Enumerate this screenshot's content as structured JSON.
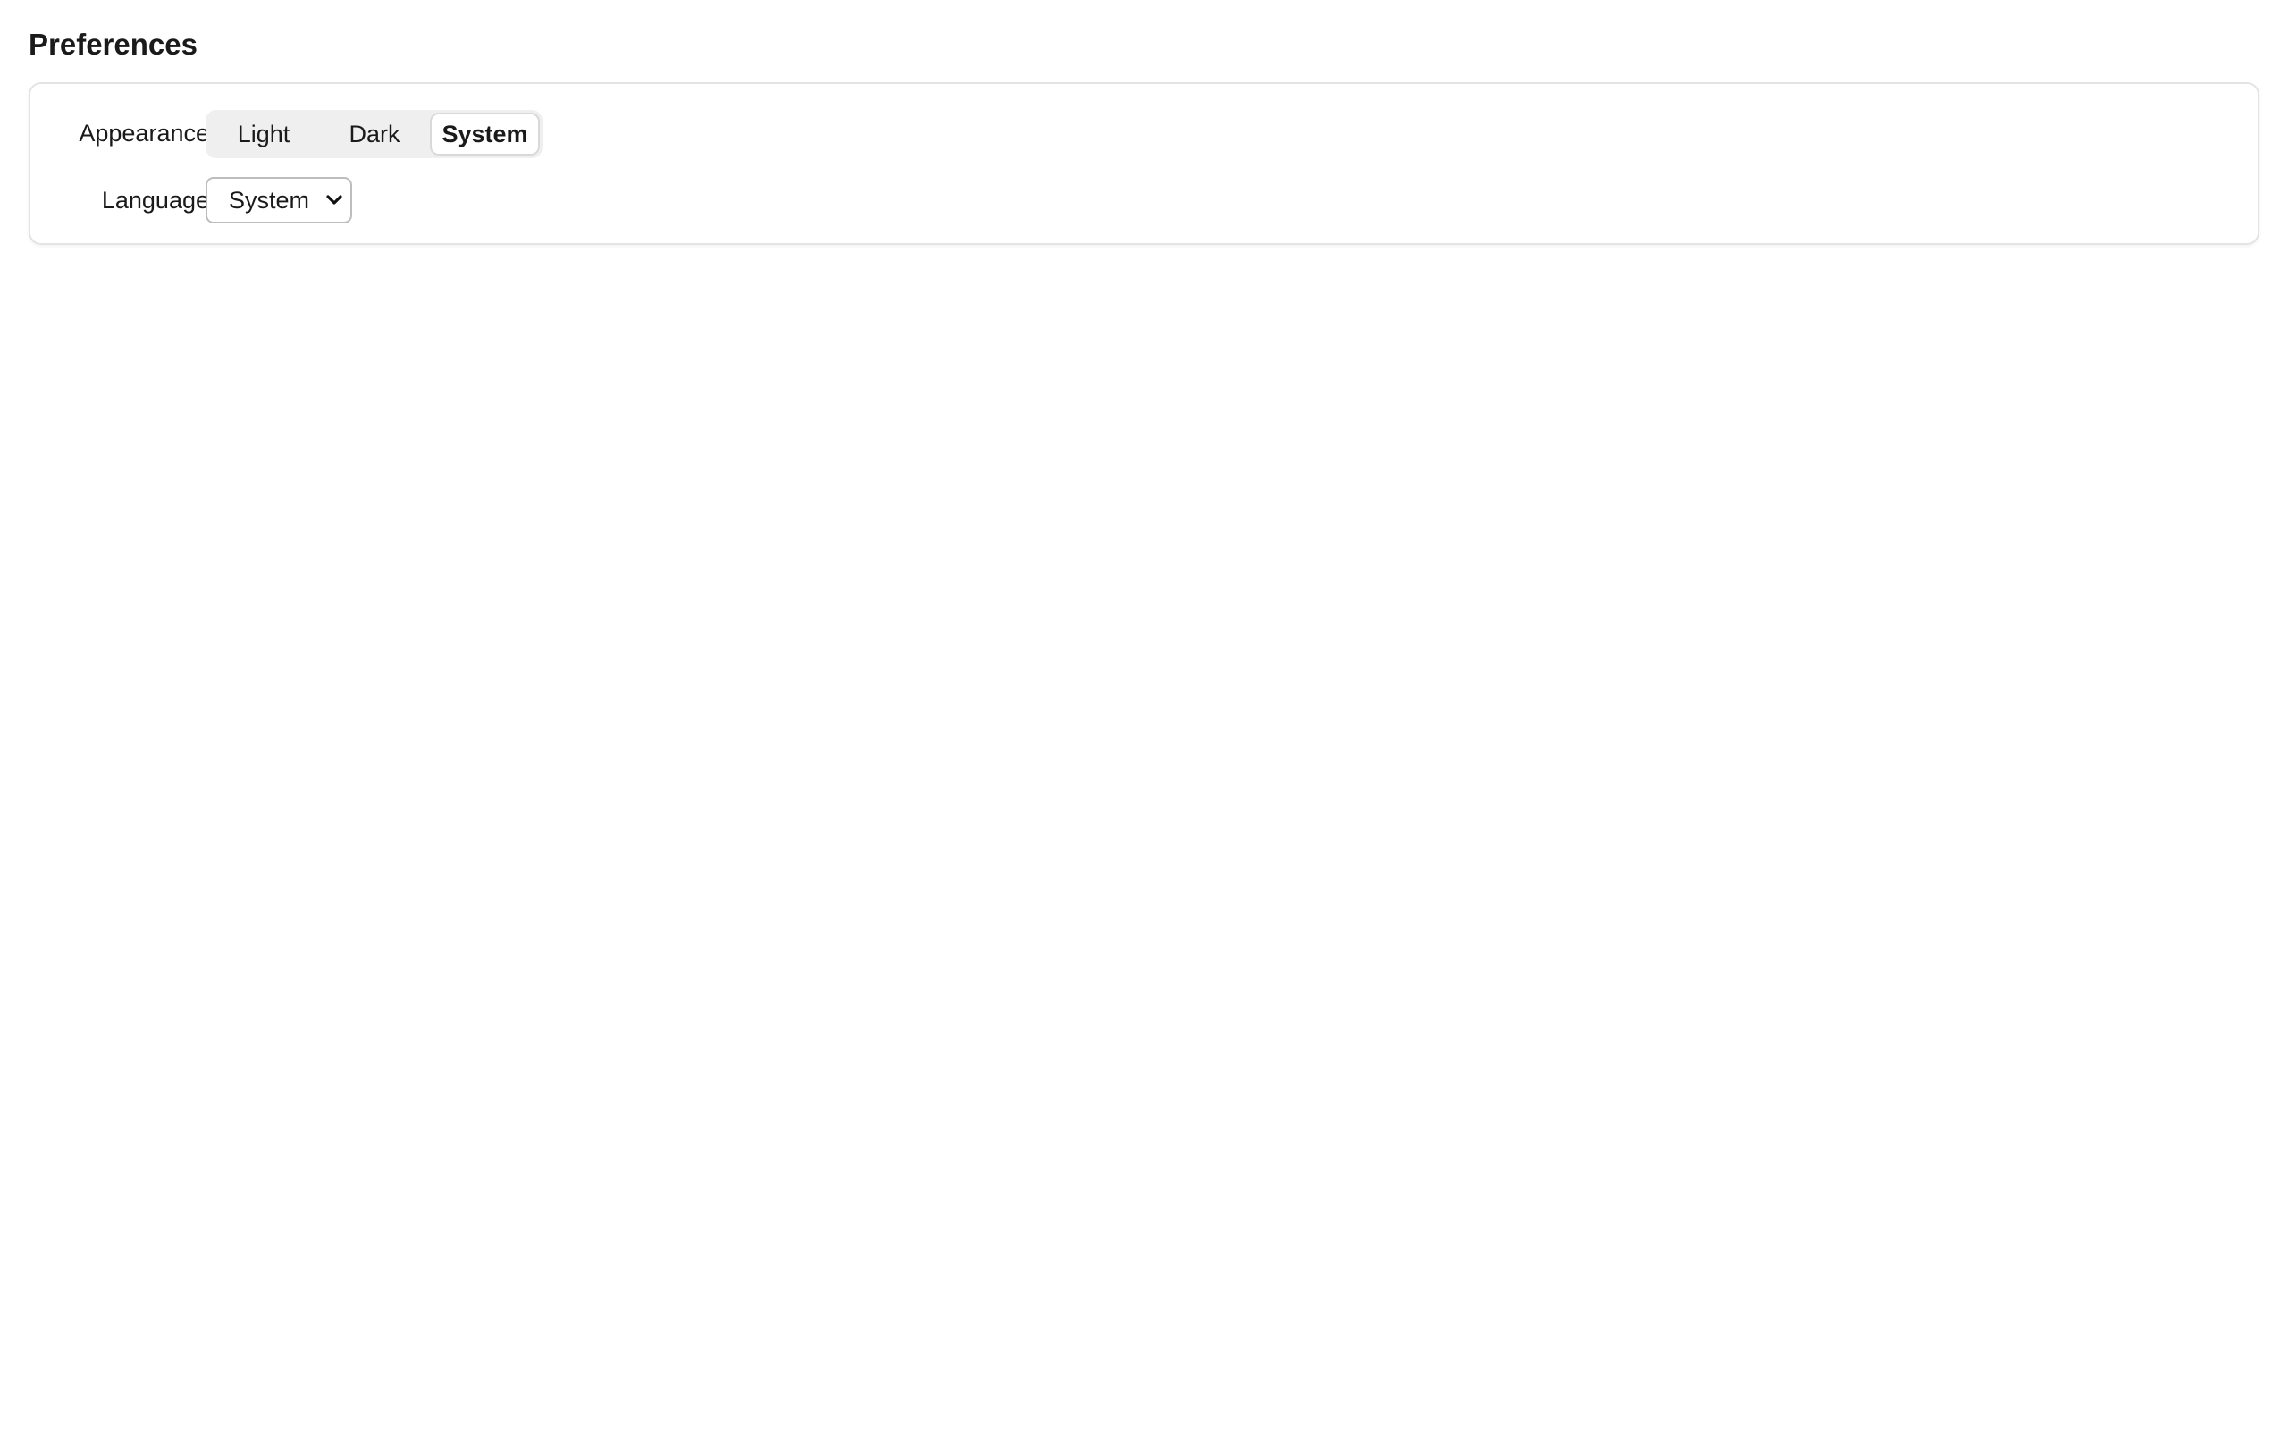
{
  "page": {
    "title": "Preferences"
  },
  "appearance": {
    "label": "Appearance",
    "options": [
      "Light",
      "Dark",
      "System"
    ],
    "selected": "System"
  },
  "language": {
    "label": "Language",
    "value": "System",
    "icon": "chevron-down-icon"
  },
  "colors": {
    "card_border": "#e4e4e4",
    "segment_bg": "#efefef",
    "selected_segment_bg": "#ffffff"
  }
}
